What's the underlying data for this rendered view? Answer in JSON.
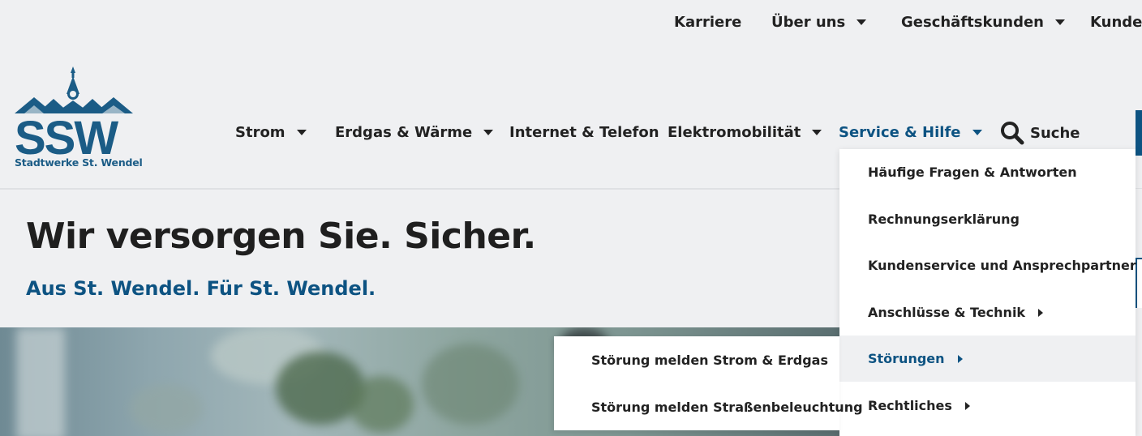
{
  "topnav": {
    "items": [
      {
        "label": "Karriere",
        "dropdown": false
      },
      {
        "label": "Über uns",
        "dropdown": true
      },
      {
        "label": "Geschäftskunden",
        "dropdown": true
      },
      {
        "label": "Kunden",
        "dropdown": false
      }
    ]
  },
  "logo": {
    "text": "SSW",
    "subtitle": "Stadtwerke St. Wendel"
  },
  "mainnav": {
    "items": [
      {
        "label": "Strom",
        "dropdown": true
      },
      {
        "label": "Erdgas & Wärme",
        "dropdown": true
      },
      {
        "label": "Internet & Telefon",
        "dropdown": false
      },
      {
        "label": "Elektromobilität",
        "dropdown": true
      },
      {
        "label": "Service & Hilfe",
        "dropdown": true,
        "active": true
      }
    ],
    "search_label": "Suche"
  },
  "hero": {
    "title": "Wir versorgen Sie. Sicher.",
    "subtitle": "Aus St. Wendel. Für St. Wendel."
  },
  "dropdown": {
    "items": [
      {
        "label": "Häufige Fragen & Antworten",
        "has_submenu": false
      },
      {
        "label": "Rechnungserklärung",
        "has_submenu": false
      },
      {
        "label": "Kundenservice und Ansprechpartner",
        "has_submenu": true
      },
      {
        "label": "Anschlüsse & Technik",
        "has_submenu": true
      },
      {
        "label": "Störungen",
        "has_submenu": true,
        "active": true
      },
      {
        "label": "Rechtliches",
        "has_submenu": true
      }
    ]
  },
  "submenu": {
    "items": [
      {
        "label": "Störung melden Strom & Erdgas"
      },
      {
        "label": "Störung melden Straßenbeleuchtung"
      }
    ]
  },
  "colors": {
    "brand_blue": "#0d5382",
    "logo_blue": "#1b5c86",
    "background": "#eff0f2",
    "text": "#222222"
  }
}
